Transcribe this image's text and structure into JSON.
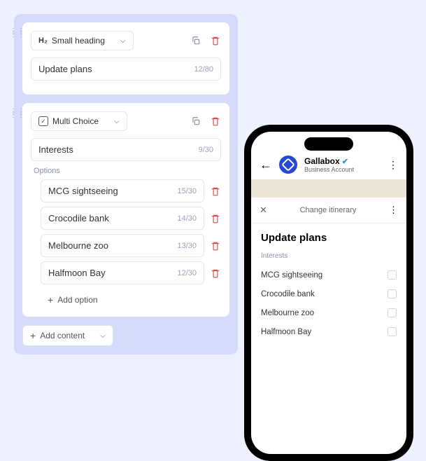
{
  "builder": {
    "headingBlock": {
      "typeIcon": "H₂",
      "typeLabel": "Small heading",
      "value": "Update plans",
      "counter": "12/80"
    },
    "choiceBlock": {
      "typeLabel": "Multi Choice",
      "value": "Interests",
      "counter": "9/30",
      "optionsLabel": "Options",
      "options": [
        {
          "text": "MCG sightseeing",
          "counter": "15/30"
        },
        {
          "text": "Crocodile bank",
          "counter": "14/30"
        },
        {
          "text": "Melbourne zoo",
          "counter": "13/30"
        },
        {
          "text": "Halfmoon Bay",
          "counter": "12/30"
        }
      ],
      "addOption": "Add option"
    },
    "addContent": "Add content"
  },
  "phone": {
    "accountName": "Gallabox",
    "accountSub": "Business Account",
    "sheetTitle": "Change itinerary",
    "heading": "Update plans",
    "interestsLabel": "Interests",
    "choices": [
      "MCG sightseeing",
      "Crocodile bank",
      "Melbourne zoo",
      "Halfmoon Bay"
    ]
  }
}
